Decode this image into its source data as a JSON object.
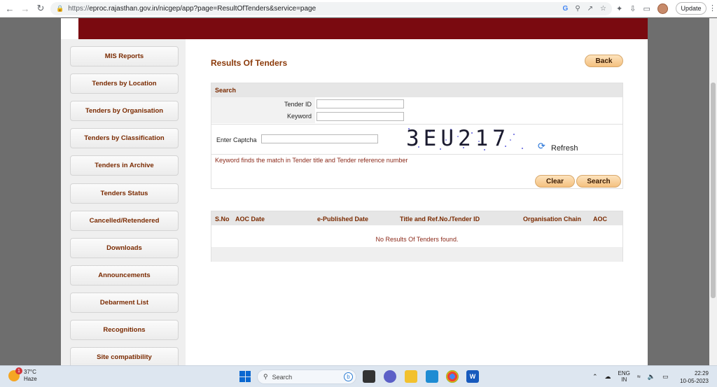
{
  "browser": {
    "url_scheme": "https://",
    "url_rest": "eproc.rajasthan.gov.in/nicgep/app?page=ResultOfTenders&service=page",
    "update_label": "Update",
    "icons": [
      "back-arrow-icon",
      "forward-arrow-icon",
      "reload-icon",
      "lock-icon",
      "google-icon",
      "zoom-icon",
      "share-icon",
      "star-icon",
      "extensions-icon",
      "download-icon",
      "sidepanel-icon",
      "profile-avatar",
      "kebab-menu-icon"
    ]
  },
  "sidebar": {
    "items": [
      {
        "label": "MIS Reports"
      },
      {
        "label": "Tenders by Location"
      },
      {
        "label": "Tenders by Organisation"
      },
      {
        "label": "Tenders by Classification"
      },
      {
        "label": "Tenders in Archive"
      },
      {
        "label": "Tenders Status"
      },
      {
        "label": "Cancelled/Retendered"
      },
      {
        "label": "Downloads"
      },
      {
        "label": "Announcements"
      },
      {
        "label": "Debarment List"
      },
      {
        "label": "Recognitions"
      },
      {
        "label": "Site compatibility"
      }
    ]
  },
  "main": {
    "title": "Results Of Tenders",
    "back_label": "Back",
    "search": {
      "heading": "Search",
      "tender_id_label": "Tender ID",
      "tender_id_value": "",
      "keyword_label": "Keyword",
      "keyword_value": "",
      "captcha_label": "Enter Captcha",
      "captcha_value": "",
      "captcha_image_text": "3EU217",
      "refresh_label": "Refresh",
      "hint": "Keyword finds the match in Tender title and Tender reference number",
      "clear_label": "Clear",
      "search_label": "Search"
    },
    "results": {
      "columns": [
        "S.No",
        "AOC Date",
        "e-Published Date",
        "Title and Ref.No./Tender ID",
        "Organisation Chain",
        "AOC"
      ],
      "empty_message": "No Results Of Tenders found."
    }
  },
  "taskbar": {
    "weather_temp": "37°C",
    "weather_desc": "Haze",
    "notification_count": "1",
    "search_label": "Search",
    "lang_line1": "ENG",
    "lang_line2": "IN",
    "time": "22:29",
    "date": "10-05-2023"
  },
  "colors": {
    "header_band": "#7a0a10",
    "accent_text": "#7a2a00",
    "button_gradient_top": "#fde3bd",
    "button_gradient_bottom": "#f4c07f"
  }
}
